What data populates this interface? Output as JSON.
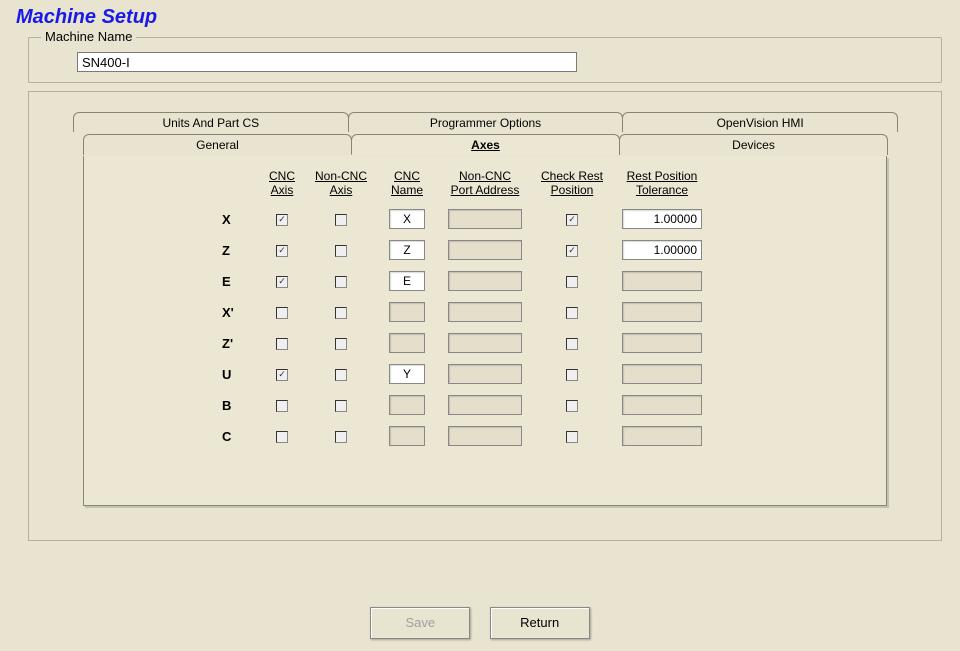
{
  "page_title": "Machine Setup",
  "machine_name_group": {
    "label": "Machine Name",
    "value": "SN400-I"
  },
  "tabs_row1": [
    {
      "label": "Units And Part CS"
    },
    {
      "label": "Programmer Options"
    },
    {
      "label": "OpenVision HMI"
    }
  ],
  "tabs_row2": [
    {
      "label": "General"
    },
    {
      "label": "Axes"
    },
    {
      "label": "Devices"
    }
  ],
  "active_tab": "Axes",
  "columns": {
    "cnc_axis": "CNC\nAxis",
    "noncnc_axis": "Non-CNC\nAxis",
    "cnc_name": "CNC\nName",
    "noncnc_port": "Non-CNC\nPort Address",
    "check_rest": "Check Rest\nPosition",
    "rest_tol": "Rest Position\nTolerance"
  },
  "axes": [
    {
      "label": "X",
      "cnc_axis": true,
      "noncnc_axis": false,
      "cnc_name": "X",
      "noncnc_port": "",
      "check_rest": true,
      "rest_tol": "1.00000"
    },
    {
      "label": "Z",
      "cnc_axis": true,
      "noncnc_axis": false,
      "cnc_name": "Z",
      "noncnc_port": "",
      "check_rest": true,
      "rest_tol": "1.00000"
    },
    {
      "label": "E",
      "cnc_axis": true,
      "noncnc_axis": false,
      "cnc_name": "E",
      "noncnc_port": "",
      "check_rest": false,
      "rest_tol": ""
    },
    {
      "label": "X'",
      "cnc_axis": false,
      "noncnc_axis": false,
      "cnc_name": "",
      "noncnc_port": "",
      "check_rest": false,
      "rest_tol": ""
    },
    {
      "label": "Z'",
      "cnc_axis": false,
      "noncnc_axis": false,
      "cnc_name": "",
      "noncnc_port": "",
      "check_rest": false,
      "rest_tol": ""
    },
    {
      "label": "U",
      "cnc_axis": true,
      "noncnc_axis": false,
      "cnc_name": "Y",
      "noncnc_port": "",
      "check_rest": false,
      "rest_tol": ""
    },
    {
      "label": "B",
      "cnc_axis": false,
      "noncnc_axis": false,
      "cnc_name": "",
      "noncnc_port": "",
      "check_rest": false,
      "rest_tol": ""
    },
    {
      "label": "C",
      "cnc_axis": false,
      "noncnc_axis": false,
      "cnc_name": "",
      "noncnc_port": "",
      "check_rest": false,
      "rest_tol": ""
    }
  ],
  "buttons": {
    "save": "Save",
    "return": "Return"
  }
}
